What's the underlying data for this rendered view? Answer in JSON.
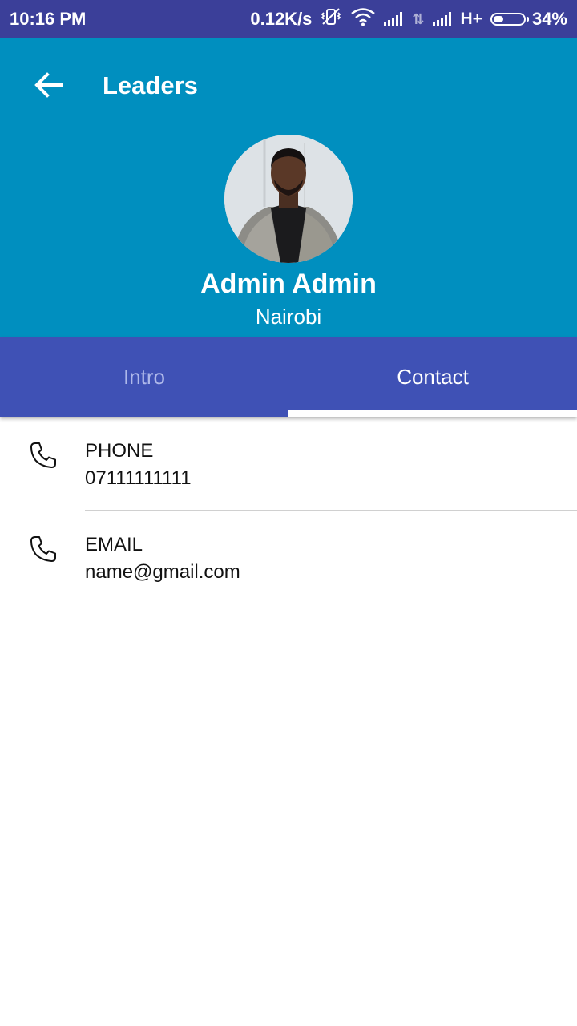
{
  "status_bar": {
    "time": "10:16 PM",
    "speed": "0.12K/s",
    "network_type": "H+",
    "battery_percent": "34%",
    "battery_level": 0.34
  },
  "header": {
    "title": "Leaders",
    "back_icon": "arrow-left-icon"
  },
  "profile": {
    "name": "Admin Admin",
    "location": "Nairobi"
  },
  "tabs": [
    {
      "label": "Intro",
      "active": false
    },
    {
      "label": "Contact",
      "active": true
    }
  ],
  "contacts": [
    {
      "label": "PHONE",
      "value": "07111111111",
      "icon": "phone-icon"
    },
    {
      "label": "EMAIL",
      "value": "name@gmail.com",
      "icon": "phone-icon"
    }
  ],
  "colors": {
    "status_bar": "#3b3f99",
    "header": "#008fbf",
    "tab_bar": "#3f51b5",
    "tab_inactive_text": "#aeb8ea"
  }
}
